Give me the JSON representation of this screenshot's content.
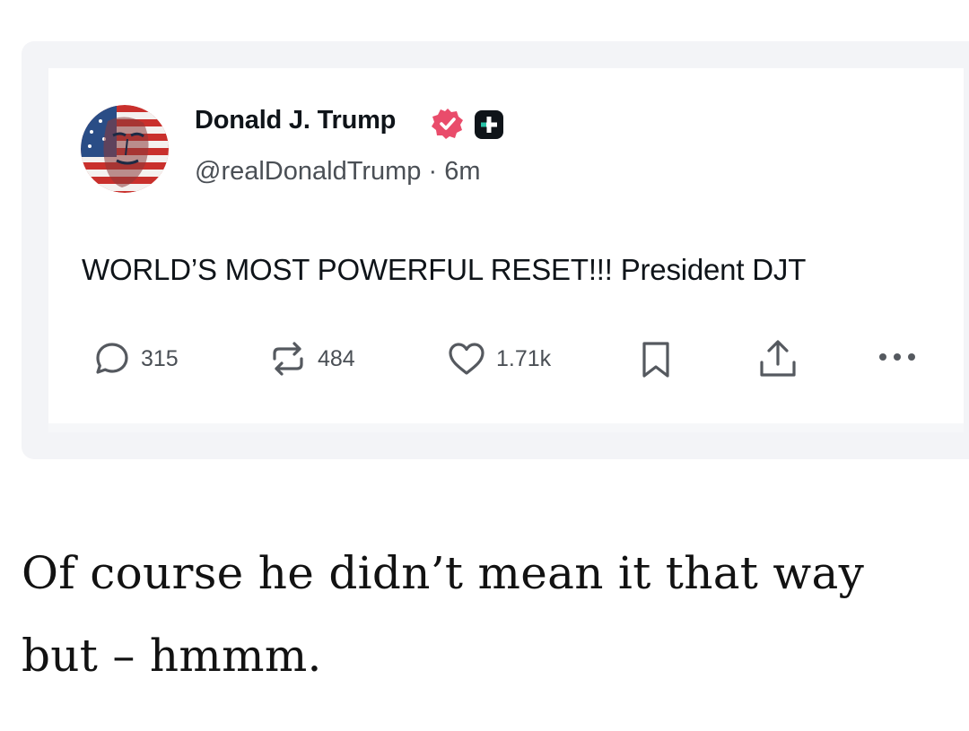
{
  "post": {
    "author_name": "Donald J. Trump",
    "handle": "@realDonaldTrump",
    "separator": "·",
    "time_ago": "6m",
    "text": "WORLD’S MOST POWERFUL RESET!!! President DJT",
    "avatar_icon": "flag-portrait-avatar",
    "badges": [
      "verified-badge-icon",
      "plus-badge-icon"
    ],
    "badge_colors": {
      "verified": "#e94c6b",
      "plus": "#0f1419"
    },
    "actions": {
      "replies": "315",
      "reposts": "484",
      "likes": "1.71k"
    },
    "action_icons": [
      "reply-icon",
      "repost-icon",
      "heart-icon",
      "bookmark-icon",
      "share-icon",
      "more-icon"
    ]
  },
  "caption": "Of course he didn’t mean it that way but – hmmm."
}
